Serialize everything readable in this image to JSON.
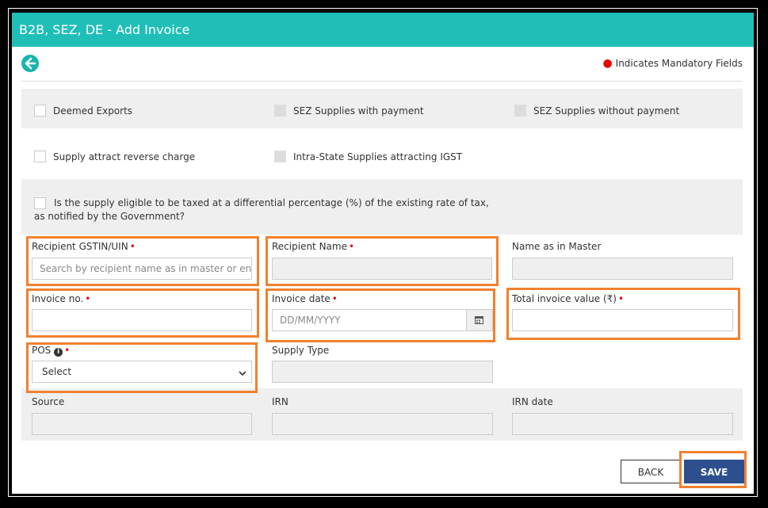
{
  "window": {
    "title": "B2B, SEZ, DE - Add Invoice"
  },
  "header": {
    "mandatory_note": "Indicates Mandatory Fields"
  },
  "checkboxes": {
    "deemed_exports": "Deemed Exports",
    "sez_with_payment": "SEZ Supplies with payment",
    "sez_without_payment": "SEZ Supplies without payment",
    "reverse_charge": "Supply attract reverse charge",
    "intra_state_igst": "Intra-State Supplies attracting IGST",
    "differential_line1": "Is the supply eligible to be taxed at a differential percentage (%) of the existing rate of tax,",
    "differential_line2": "as notified by the Government?"
  },
  "fields": {
    "recipient_gstin": {
      "label": "Recipient GSTIN/UIN",
      "placeholder": "Search by recipient name as in master or enter GSTIN/UIN"
    },
    "recipient_name": {
      "label": "Recipient Name"
    },
    "name_as_in_master": {
      "label": "Name as in Master"
    },
    "invoice_no": {
      "label": "Invoice no."
    },
    "invoice_date": {
      "label": "Invoice date",
      "placeholder": "DD/MM/YYYY"
    },
    "total_invoice_value": {
      "label": "Total invoice value (₹)"
    },
    "pos": {
      "label": "POS",
      "selected": "Select"
    },
    "supply_type": {
      "label": "Supply Type"
    },
    "source": {
      "label": "Source"
    },
    "irn": {
      "label": "IRN"
    },
    "irn_date": {
      "label": "IRN date"
    }
  },
  "buttons": {
    "back": "BACK",
    "save": "SAVE"
  },
  "colors": {
    "title_bar": "#1fbfb8",
    "highlight": "#f2802e",
    "save_button": "#2e4f8e"
  }
}
